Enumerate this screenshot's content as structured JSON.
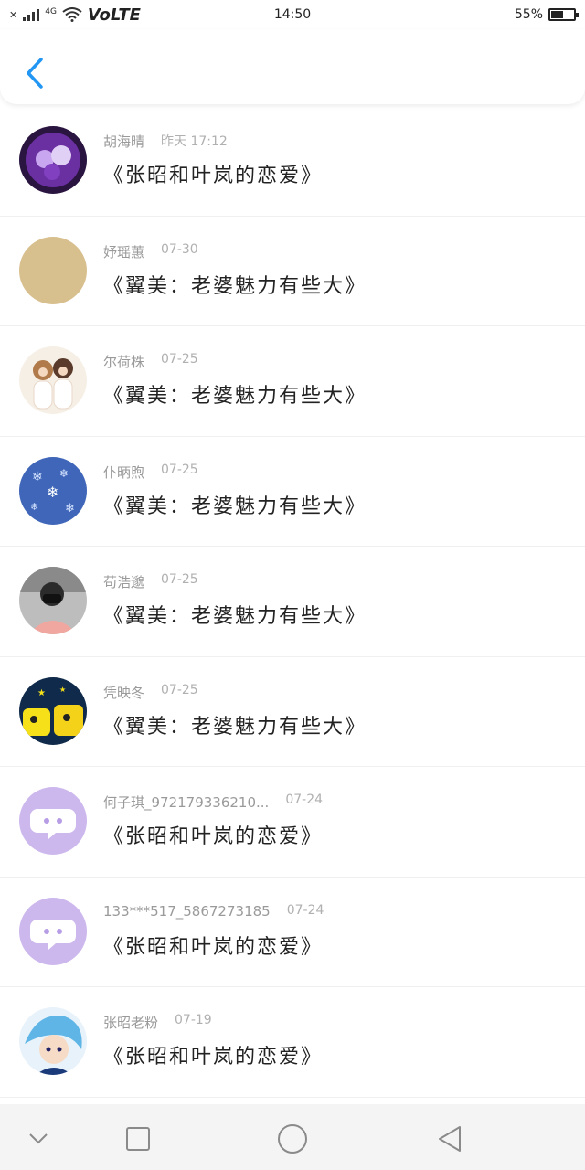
{
  "statusbar": {
    "network": "4G",
    "volte": "VoLTE",
    "time": "14:50",
    "battery_text": "55%",
    "battery_level": 0.55
  },
  "header": {
    "back_icon": "chevron-left-icon",
    "accent": "#2196F3"
  },
  "items": [
    {
      "name": "胡海晴",
      "date": "昨天 17:12",
      "title": "《张昭和叶岚的恋爱》",
      "avatar": "anime-purple"
    },
    {
      "name": "妤瑶蕙",
      "date": "07-30",
      "title": "《翼美：老婆魅力有些大》",
      "avatar": "tan-circle"
    },
    {
      "name": "尔荷株",
      "date": "07-25",
      "title": "《翼美：老婆魅力有些大》",
      "avatar": "anime-girls"
    },
    {
      "name": "仆昞煦",
      "date": "07-25",
      "title": "《翼美：老婆魅力有些大》",
      "avatar": "snowflakes"
    },
    {
      "name": "苟浩邈",
      "date": "07-25",
      "title": "《翼美：老婆魅力有些大》",
      "avatar": "man-mask"
    },
    {
      "name": "凭映冬",
      "date": "07-25",
      "title": "《翼美：老婆魅力有些大》",
      "avatar": "cartoon-yellow"
    },
    {
      "name": "何子琪_972179336210...",
      "date": "07-24",
      "title": "《张昭和叶岚的恋爱》",
      "avatar": "default-chat"
    },
    {
      "name": "133***517_5867273185",
      "date": "07-24",
      "title": "《张昭和叶岚的恋爱》",
      "avatar": "default-chat"
    },
    {
      "name": "张昭老粉",
      "date": "07-19",
      "title": "《张昭和叶岚的恋爱》",
      "avatar": "anime-blue"
    }
  ],
  "navbar": {
    "icons": [
      "chevron-down-icon",
      "square-icon",
      "circle-icon",
      "triangle-back-icon"
    ]
  }
}
